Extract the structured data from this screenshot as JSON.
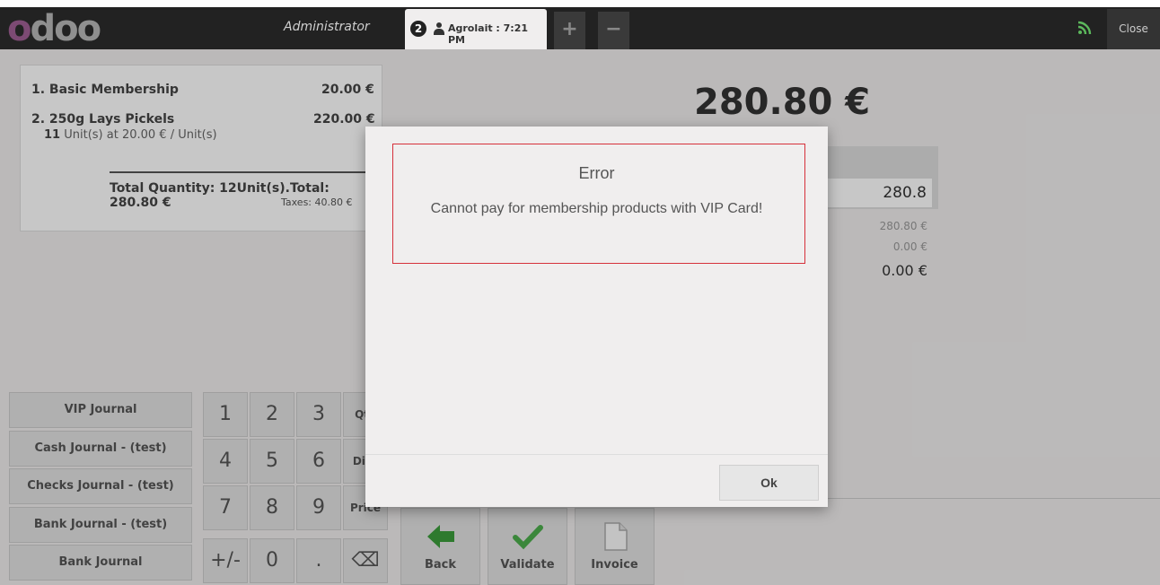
{
  "header": {
    "logo": "odoo",
    "user": "Administrator",
    "order_tab": {
      "number": "2",
      "label": "Agrolait : 7:21 PM"
    },
    "add_tab": "+",
    "remove_tab": "−",
    "close_label": "Close",
    "icons": {
      "connection": "wifi-icon",
      "customer": "user-icon"
    }
  },
  "order": {
    "lines": [
      {
        "name": "1. Basic Membership",
        "price": "20.00 €"
      },
      {
        "name": "2. 250g Lays Pickels",
        "price": "220.00 €",
        "qty": "11",
        "detail": "Unit(s) at 20.00 € / Unit(s)"
      }
    ],
    "total": "Total Quantity: 12Unit(s).Total: 280.80 €",
    "taxes": "Taxes: 40.80 €"
  },
  "payment": {
    "total": "280.80 €",
    "input_value": "280.8",
    "tendered": "280.80 €",
    "change": "0.00 €",
    "remaining": "0.00 €"
  },
  "journals": [
    "VIP Journal",
    "Cash Journal - (test)",
    "Checks Journal - (test)",
    "Bank Journal - (test)",
    "Bank Journal"
  ],
  "numpad": {
    "keys": [
      "1",
      "2",
      "3",
      "Qty",
      "4",
      "5",
      "6",
      "Disc",
      "7",
      "8",
      "9",
      "Price",
      "+/-",
      "0",
      ".",
      "⌫"
    ]
  },
  "actions": {
    "back": "Back",
    "validate": "Validate",
    "invoice": "Invoice"
  },
  "dialog": {
    "title": "Error",
    "message": "Cannot pay for membership products with VIP Card!",
    "ok_label": "Ok"
  },
  "colors": {
    "accent": "#d6303a",
    "logo_purple": "#7c4a73",
    "wifi": "#5cb85c",
    "back_green": "#3c9d3c"
  }
}
